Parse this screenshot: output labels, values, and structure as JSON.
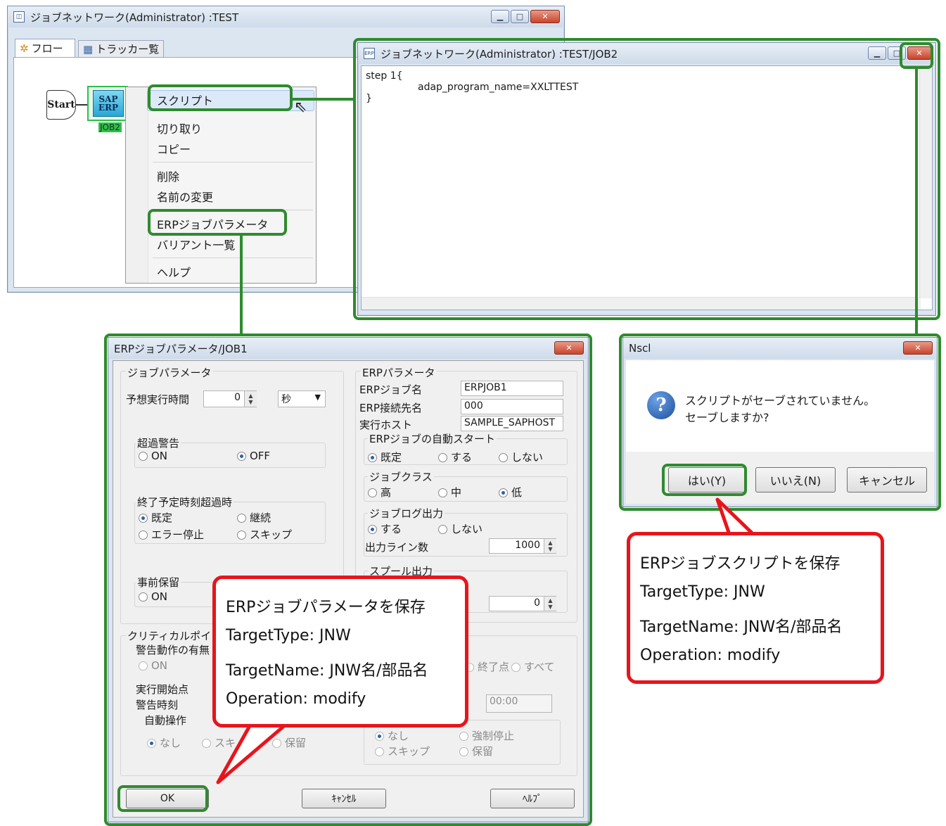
{
  "main_window": {
    "title": "ジョブネットワーク(Administrator) :TEST",
    "tabs": [
      {
        "label": "フロー"
      },
      {
        "label": "トラッカー覧"
      }
    ],
    "flow": {
      "start_label": "Start",
      "job_icon_top": "SAP",
      "job_icon_bottom": "ERP",
      "job_name": "JOB2"
    }
  },
  "context_menu": {
    "items": [
      "スクリプト",
      "切り取り",
      "コピー",
      "削除",
      "名前の変更",
      "ERPジョブパラメータ",
      "バリアント一覧",
      "ヘルプ"
    ]
  },
  "script_window": {
    "title": "ジョブネットワーク(Administrator) :TEST/JOB2",
    "lines": [
      "step 1{",
      "adap_program_name=XXLTTEST",
      "}"
    ]
  },
  "erp_dialog": {
    "title": "ERPジョブパラメータ/JOB1",
    "job_params": {
      "group_label": "ジョブパラメータ",
      "expected_time_label": "予想実行時間",
      "expected_time_value": "0",
      "unit_value": "秒",
      "overrun_label": "超過警告",
      "overrun_on": "ON",
      "overrun_off": "OFF",
      "end_time_label": "終了予定時刻超過時",
      "end_opt_default": "既定",
      "end_opt_continue": "継続",
      "end_opt_error": "エラー停止",
      "end_opt_skip": "スキップ",
      "hold_label": "事前保留",
      "hold_on": "ON",
      "critical_label": "クリティカルポイン",
      "warn_action_label": "警告動作の有無",
      "warn_on": "ON",
      "exec_start_label": "実行開始点",
      "warn_time_label": "警告時刻",
      "auto_op_label": "自動操作",
      "auto_none": "なし",
      "auto_skip": "スキ",
      "auto_hold": "保留"
    },
    "erp_params": {
      "group_label": "ERPパラメータ",
      "job_name_label": "ERPジョブ名",
      "job_name_value": "ERPJOB1",
      "dest_label": "ERP接続先名",
      "dest_value": "000",
      "host_label": "実行ホスト",
      "host_value": "SAMPLE_SAPHOST",
      "autostart_label": "ERPジョブの自動スタート",
      "as_default": "既定",
      "as_yes": "する",
      "as_no": "しない",
      "class_label": "ジョブクラス",
      "class_high": "高",
      "class_mid": "中",
      "class_low": "低",
      "log_label": "ジョブログ出力",
      "log_yes": "する",
      "log_no": "しない",
      "lines_label": "出力ライン数",
      "lines_value": "1000",
      "spool_label": "スプール出力",
      "spool_value": "0",
      "end_point_label": "終了点",
      "all_label": "すべて",
      "time_value": "00:00",
      "act_none": "なし",
      "act_force": "強制停止",
      "act_skip": "スキップ",
      "act_hold": "保留"
    },
    "buttons": {
      "ok": "OK",
      "cancel": "ｷｬﾝｾﾙ",
      "help": "ﾍﾙﾌﾟ"
    }
  },
  "nscl_dialog": {
    "title": "Nscl",
    "message_line1": "スクリプトがセーブされていません。",
    "message_line2": "セーブしますか?",
    "buttons": {
      "yes": "はい(Y)",
      "no": "いいえ(N)",
      "cancel": "キャンセル"
    }
  },
  "callout_params": {
    "line1": "ERPジョブパラメータを保存",
    "line2": "TargetType: JNW",
    "line3": "TargetName: JNW名/部品名",
    "line4": "Operation: modify"
  },
  "callout_script": {
    "line1": "ERPジョブスクリプトを保存",
    "line2": "TargetType: JNW",
    "line3": "TargetName: JNW名/部品名",
    "line4": "Operation: modify"
  },
  "colors": {
    "highlight": "#2e8b2e",
    "callout_border": "#e8141c",
    "job_selected": "#2fbf4a"
  }
}
